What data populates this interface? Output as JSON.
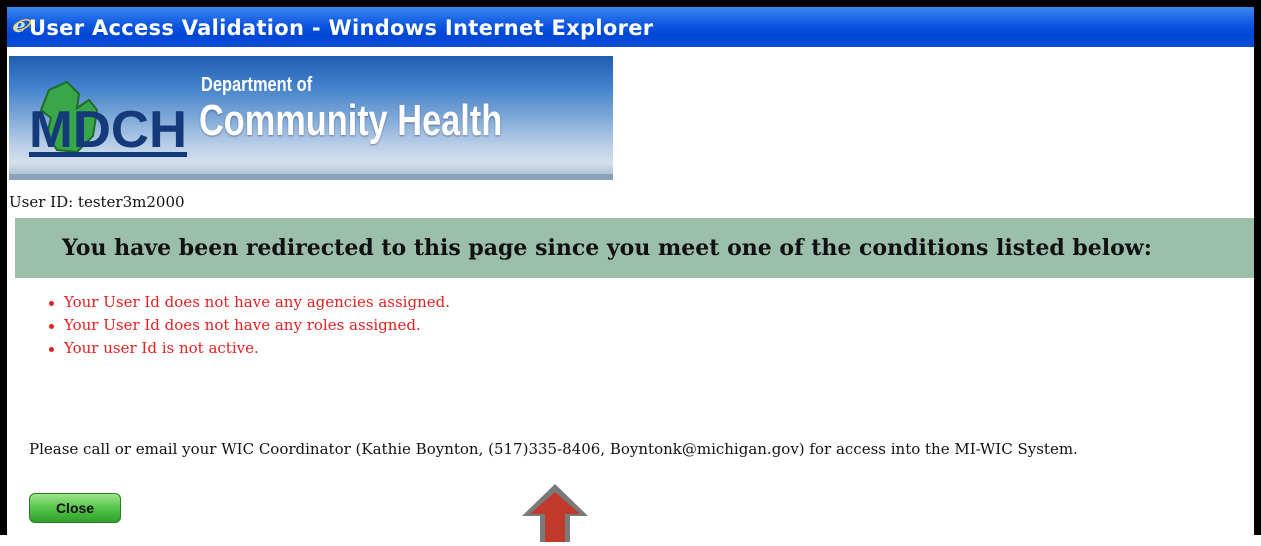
{
  "window": {
    "title": "User Access Validation - Windows Internet Explorer",
    "icon": "internet-explorer-icon"
  },
  "banner": {
    "logo_text": "MDCH",
    "dept_line": "Department of",
    "org_line": "Community Health"
  },
  "user": {
    "id_line": "User ID: tester3m2000"
  },
  "alert": {
    "message": "You have been redirected to this page since you meet one of the conditions listed below:",
    "background": "#9bbfab"
  },
  "conditions": [
    "Your User Id does not have any agencies assigned.",
    "Your User Id does not have any roles assigned.",
    "Your user Id is not active."
  ],
  "contact": {
    "text": "Please call or email your WIC Coordinator (Kathie Boynton, (517)335-8406, Boyntonk@michigan.gov) for access into the MI-WIC System."
  },
  "actions": {
    "close_label": "Close"
  },
  "colors": {
    "condition_text": "#e52020",
    "titlebar": "#0046d5",
    "annotation_arrow": "#c0392b"
  }
}
